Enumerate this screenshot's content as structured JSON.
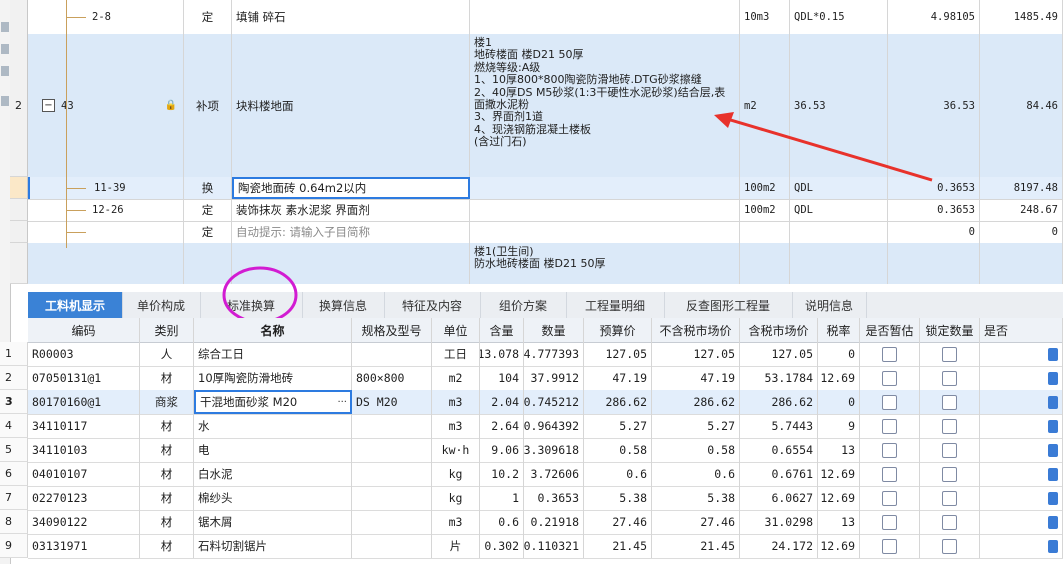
{
  "top": {
    "rows": [
      {
        "hdr": "",
        "code": "2-8",
        "type": "定",
        "name": "填铺 碎石",
        "desc": "",
        "unit": "10m3",
        "expr": "QDL*0.15",
        "qty": "4.98105",
        "price": "1485.49"
      },
      {
        "hdr": "2",
        "toggle": "−",
        "code": "43",
        "lock": "🔒",
        "type": "补项",
        "name": "块料楼地面",
        "desc": "楼1\n地砖楼面 楼D21 50厚\n燃烧等级:A级\n1、10厚800*800陶瓷防滑地砖.DTG砂浆擦缝\n2、40厚DS M5砂浆(1:3干硬性水泥砂浆)结合层,表面撒水泥粉\n3、界面剂1道\n4、现浇钢筋混凝土楼板\n(含过门石)",
        "unit": "m2",
        "expr": "36.53",
        "qty": "36.53",
        "price": "84.46"
      },
      {
        "hdr": "",
        "code": "11-39",
        "type": "换",
        "name": "陶瓷地面砖 0.64m2以内",
        "desc": "",
        "unit": "100m2",
        "expr": "QDL",
        "qty": "0.3653",
        "price": "8197.48"
      },
      {
        "hdr": "",
        "code": "12-26",
        "type": "定",
        "name": "装饰抹灰 素水泥浆 界面剂",
        "desc": "",
        "unit": "100m2",
        "expr": "QDL",
        "qty": "0.3653",
        "price": "248.67"
      },
      {
        "hdr": "",
        "code": "",
        "type": "定",
        "name": "自动提示: 请输入子目简称",
        "desc": "",
        "unit": "",
        "expr": "",
        "qty": "0",
        "price": "0"
      },
      {
        "hdr": "",
        "code": "",
        "type": "",
        "name": "",
        "desc": "楼1(卫生间)\n防水地砖楼面 楼D21 50厚",
        "unit": "",
        "expr": "",
        "qty": "",
        "price": ""
      }
    ]
  },
  "tabs": [
    {
      "label": "工料机显示"
    },
    {
      "label": "单价构成"
    },
    {
      "label": "标准换算"
    },
    {
      "label": "换算信息"
    },
    {
      "label": "特征及内容"
    },
    {
      "label": "组价方案"
    },
    {
      "label": "工程量明细"
    },
    {
      "label": "反查图形工程量"
    },
    {
      "label": "说明信息"
    }
  ],
  "grid": {
    "headers": [
      "编码",
      "类别",
      "名称",
      "规格及型号",
      "单位",
      "含量",
      "数量",
      "预算价",
      "不含税市场价",
      "含税市场价",
      "税率",
      "是否暂估",
      "锁定数量",
      "是否"
    ],
    "rows": [
      {
        "idx": "1",
        "code": "R00003",
        "cat": "人",
        "name": "综合工日",
        "spec": "",
        "unit": "工日",
        "content": "13.078",
        "qty": "4.777393",
        "budget": "127.05",
        "mkt_ex": "127.05",
        "mkt_in": "127.05",
        "tax": "0"
      },
      {
        "idx": "2",
        "code": "07050131@1",
        "cat": "材",
        "name": "10厚陶瓷防滑地砖",
        "spec": "800×800",
        "unit": "m2",
        "content": "104",
        "qty": "37.9912",
        "budget": "47.19",
        "mkt_ex": "47.19",
        "mkt_in": "53.1784",
        "tax": "12.69"
      },
      {
        "idx": "3",
        "code": "80170160@1",
        "cat": "商浆",
        "name": "干混地面砂浆 M20",
        "spec": "DS M20",
        "unit": "m3",
        "content": "2.04",
        "qty": "0.745212",
        "budget": "286.62",
        "mkt_ex": "286.62",
        "mkt_in": "286.62",
        "tax": "0"
      },
      {
        "idx": "4",
        "code": "34110117",
        "cat": "材",
        "name": "水",
        "spec": "",
        "unit": "m3",
        "content": "2.64",
        "qty": "0.964392",
        "budget": "5.27",
        "mkt_ex": "5.27",
        "mkt_in": "5.7443",
        "tax": "9"
      },
      {
        "idx": "5",
        "code": "34110103",
        "cat": "材",
        "name": "电",
        "spec": "",
        "unit": "kw·h",
        "content": "9.06",
        "qty": "3.309618",
        "budget": "0.58",
        "mkt_ex": "0.58",
        "mkt_in": "0.6554",
        "tax": "13"
      },
      {
        "idx": "6",
        "code": "04010107",
        "cat": "材",
        "name": "白水泥",
        "spec": "",
        "unit": "kg",
        "content": "10.2",
        "qty": "3.72606",
        "budget": "0.6",
        "mkt_ex": "0.6",
        "mkt_in": "0.6761",
        "tax": "12.69"
      },
      {
        "idx": "7",
        "code": "02270123",
        "cat": "材",
        "name": "棉纱头",
        "spec": "",
        "unit": "kg",
        "content": "1",
        "qty": "0.3653",
        "budget": "5.38",
        "mkt_ex": "5.38",
        "mkt_in": "6.0627",
        "tax": "12.69"
      },
      {
        "idx": "8",
        "code": "34090122",
        "cat": "材",
        "name": "锯木屑",
        "spec": "",
        "unit": "m3",
        "content": "0.6",
        "qty": "0.21918",
        "budget": "27.46",
        "mkt_ex": "27.46",
        "mkt_in": "31.0298",
        "tax": "13"
      },
      {
        "idx": "9",
        "code": "03131971",
        "cat": "材",
        "name": "石料切割锯片",
        "spec": "",
        "unit": "片",
        "content": "0.302",
        "qty": "0.110321",
        "budget": "21.45",
        "mkt_ex": "21.45",
        "mkt_in": "24.172",
        "tax": "12.69"
      }
    ]
  },
  "ellipsis": "···",
  "colors": {
    "accent": "#3a82d6",
    "annot_red": "#e8322b",
    "annot_magenta": "#d21cd2"
  }
}
